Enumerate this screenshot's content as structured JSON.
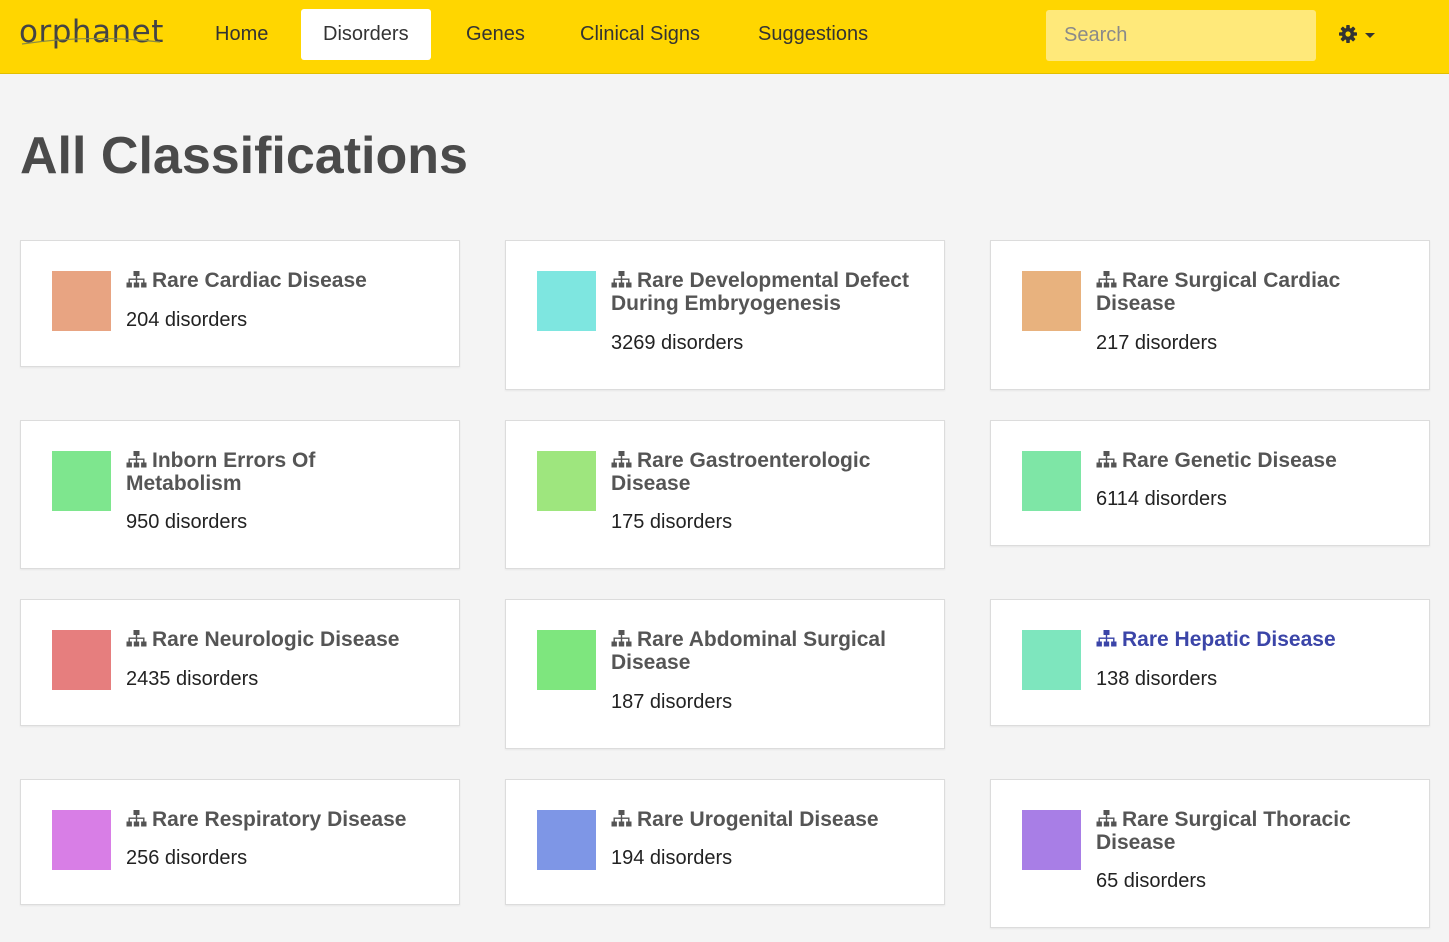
{
  "nav": {
    "logo": "orphanet",
    "items": [
      {
        "label": "Home",
        "active": false
      },
      {
        "label": "Disorders",
        "active": true
      },
      {
        "label": "Genes",
        "active": false
      },
      {
        "label": "Clinical Signs",
        "active": false
      },
      {
        "label": "Suggestions",
        "active": false
      }
    ],
    "search_placeholder": "Search",
    "settings_icon": "gear-icon"
  },
  "page": {
    "title": "All Classifications"
  },
  "cards": [
    {
      "title": "Rare Cardiac Disease",
      "count": "204 disorders",
      "color": "#e8a482",
      "link": false
    },
    {
      "title": "Rare Developmental Defect During Embryogenesis",
      "count": "3269 disorders",
      "color": "#7ee6e0",
      "link": false
    },
    {
      "title": "Rare Surgical Cardiac Disease",
      "count": "217 disorders",
      "color": "#e8b27e",
      "link": false
    },
    {
      "title": "Inborn Errors Of Metabolism",
      "count": "950 disorders",
      "color": "#7ee68e",
      "link": false
    },
    {
      "title": "Rare Gastroenterologic Disease",
      "count": "175 disorders",
      "color": "#9ee67e",
      "link": false
    },
    {
      "title": "Rare Genetic Disease",
      "count": "6114 disorders",
      "color": "#7ee6a6",
      "link": false
    },
    {
      "title": "Rare Neurologic Disease",
      "count": "2435 disorders",
      "color": "#e67e7e",
      "link": false
    },
    {
      "title": "Rare Abdominal Surgical Disease",
      "count": "187 disorders",
      "color": "#7ee67e",
      "link": false
    },
    {
      "title": "Rare Hepatic Disease",
      "count": "138 disorders",
      "color": "#7ee6be",
      "link": true
    },
    {
      "title": "Rare Respiratory Disease",
      "count": "256 disorders",
      "color": "#d87ee6",
      "link": false
    },
    {
      "title": "Rare Urogenital Disease",
      "count": "194 disorders",
      "color": "#7e96e6",
      "link": false
    },
    {
      "title": "Rare Surgical Thoracic Disease",
      "count": "65 disorders",
      "color": "#a87ee6",
      "link": false
    }
  ]
}
